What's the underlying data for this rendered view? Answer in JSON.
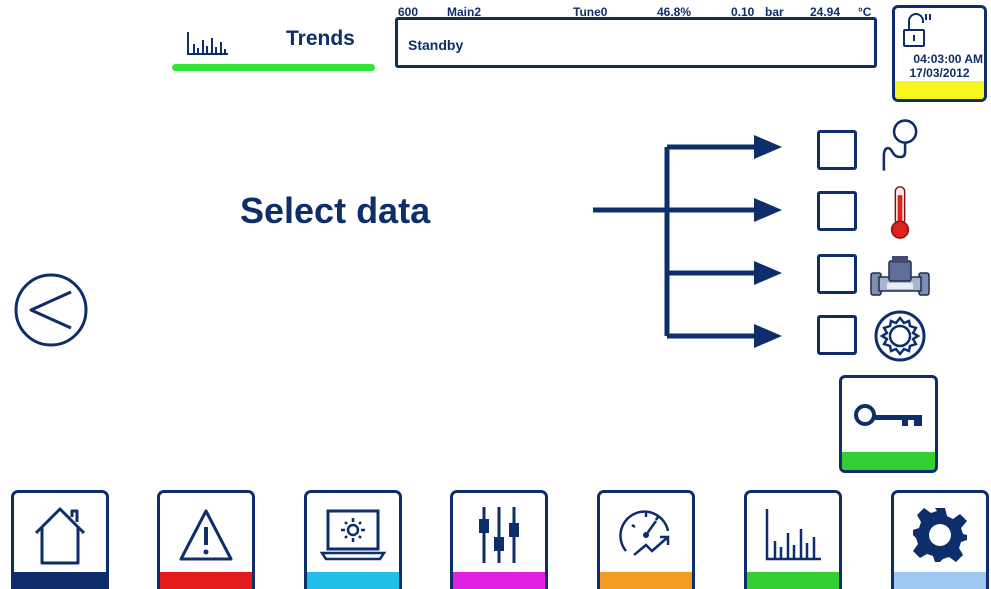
{
  "header": {
    "title": "Trends",
    "status_values": {
      "id": "600",
      "mode": "Main2",
      "tune": "Tune0",
      "percent": "46.8%",
      "pressure": "0.10",
      "pressure_unit": "bar",
      "temperature": "24.94",
      "temperature_unit": "°C"
    },
    "status_text": "Standby",
    "clock": {
      "time": "04:03:00 AM",
      "date": "17/03/2012"
    }
  },
  "main": {
    "prompt": "Select data",
    "options": [
      {
        "icon": "pressure-gauge-icon",
        "checked": false
      },
      {
        "icon": "thermometer-icon",
        "checked": false
      },
      {
        "icon": "flow-meter-icon",
        "checked": false
      },
      {
        "icon": "gear-wheel-icon",
        "checked": false
      }
    ]
  },
  "nav": [
    {
      "icon": "home-icon",
      "color": "#0d2d6b"
    },
    {
      "icon": "warning-icon",
      "color": "#e61c1c"
    },
    {
      "icon": "laptop-gear-icon",
      "color": "#1fbfea"
    },
    {
      "icon": "sliders-icon",
      "color": "#e01fe0"
    },
    {
      "icon": "performance-gauge-icon",
      "color": "#f39c1f"
    },
    {
      "icon": "bar-chart-icon",
      "color": "#33d033"
    },
    {
      "icon": "settings-gear-icon",
      "color": "#9cc8f2"
    }
  ],
  "colors": {
    "primary": "#0d2d6b",
    "trends_accent": "#33e633",
    "lock_accent": "#f5f51f",
    "key_accent": "#33d033",
    "thermo_red": "#e01f1f"
  }
}
